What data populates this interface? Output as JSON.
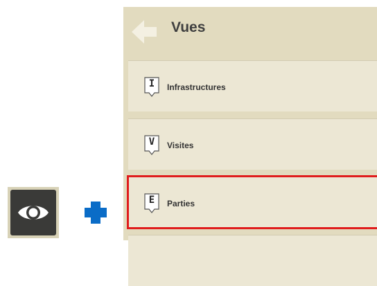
{
  "panel": {
    "title": "Vues",
    "items": [
      {
        "badge": "I",
        "label": "Infrastructures"
      },
      {
        "badge": "V",
        "label": "Visites"
      },
      {
        "badge": "E",
        "label": "Parties"
      }
    ],
    "selected_index": 2
  },
  "colors": {
    "panel_bg": "#e2dbbf",
    "item_bg": "#ece7d4",
    "selection_border": "#e01c1c",
    "plus": "#0a6cc7",
    "eye_button_bg": "#3a3a38"
  },
  "icons": {
    "back": "arrow-left-icon",
    "view_toggle": "eye-icon",
    "add": "plus-icon"
  }
}
